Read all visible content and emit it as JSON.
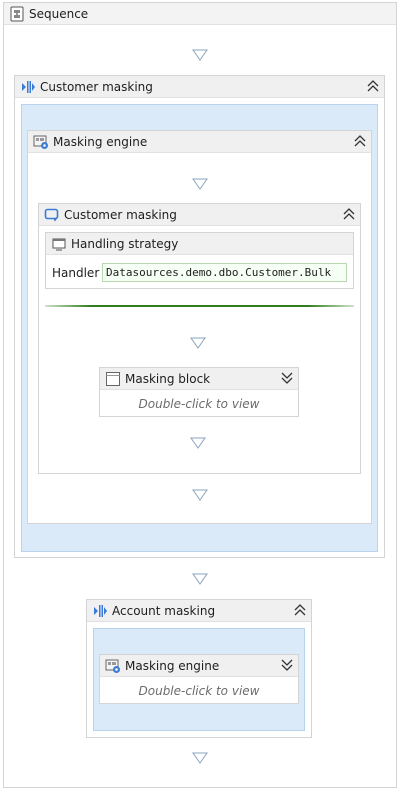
{
  "sequence": {
    "title": "Sequence"
  },
  "outer_customer_masking": {
    "title": "Customer masking"
  },
  "masking_engine_1": {
    "title": "Masking engine"
  },
  "inner_customer_masking": {
    "title": "Customer masking"
  },
  "handling_strategy": {
    "title": "Handling strategy",
    "handler_label": "Handler",
    "handler_value": "Datasources.demo.dbo.Customer.Bulk"
  },
  "masking_block": {
    "title": "Masking block",
    "hint": "Double-click to view"
  },
  "account_masking": {
    "title": "Account masking"
  },
  "masking_engine_2": {
    "title": "Masking engine",
    "hint": "Double-click to view"
  },
  "colors": {
    "accent_green": "#2e7d1e",
    "container_blue": "#dbeaf8",
    "header_gray": "#f0f0f0"
  }
}
